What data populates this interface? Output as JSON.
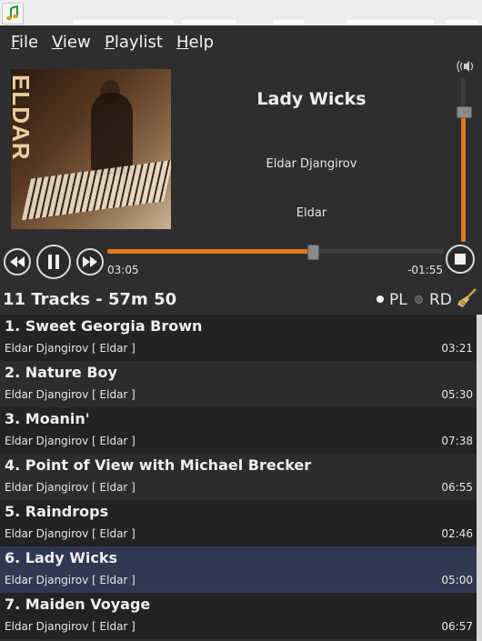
{
  "menu": [
    "File",
    "View",
    "Playlist",
    "Help"
  ],
  "now_playing": {
    "title": "Lady Wicks",
    "artist": "Eldar Djangirov",
    "album": "Eldar",
    "cover_text": "ELDAR",
    "elapsed": "03:05",
    "remaining": "-01:55",
    "progress_fraction": 0.61
  },
  "volume_fraction": 0.79,
  "playlist": {
    "summary": "11 Tracks - 57m 50",
    "mode_pl": "PL",
    "mode_rd": "RD",
    "selected_index": 5,
    "tracks": [
      {
        "name": "1. Sweet Georgia Brown",
        "sub": "Eldar Djangirov [ Eldar ]",
        "duration": "03:21"
      },
      {
        "name": "2. Nature Boy",
        "sub": "Eldar Djangirov [ Eldar ]",
        "duration": "05:30"
      },
      {
        "name": "3. Moanin'",
        "sub": "Eldar Djangirov [ Eldar ]",
        "duration": "07:38"
      },
      {
        "name": "4. Point of View with Michael Brecker",
        "sub": "Eldar Djangirov [ Eldar ]",
        "duration": "06:55"
      },
      {
        "name": "5. Raindrops",
        "sub": "Eldar Djangirov [ Eldar ]",
        "duration": "02:46"
      },
      {
        "name": "6. Lady Wicks",
        "sub": "Eldar Djangirov [ Eldar ]",
        "duration": "05:00"
      },
      {
        "name": "7. Maiden Voyage",
        "sub": "Eldar Djangirov [ Eldar ]",
        "duration": "06:57"
      }
    ]
  },
  "colors": {
    "accent": "#e07a1a",
    "background": "#2e2e2e",
    "selected_row": "#2f3a52"
  },
  "icons": {
    "app": "music-note-icon",
    "volume": "speaker-icon",
    "prev": "rewind-icon",
    "play": "pause-icon",
    "next": "fast-forward-icon",
    "stop": "stop-icon",
    "clear": "broom-icon"
  }
}
